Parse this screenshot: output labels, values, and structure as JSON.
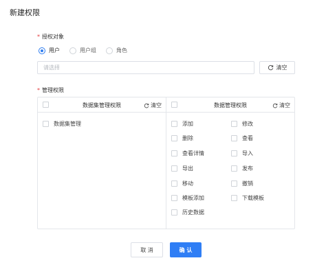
{
  "dialog": {
    "title": "新建权限"
  },
  "auth_target": {
    "label": "授权对象",
    "options": [
      {
        "label": "用户",
        "checked": true
      },
      {
        "label": "用户组",
        "checked": false
      },
      {
        "label": "角色",
        "checked": false
      }
    ],
    "select_placeholder": "请选择",
    "clear_label": "清空"
  },
  "manage_perm": {
    "label": "管理权限",
    "left_panel": {
      "title": "数据集管理权限",
      "clear_label": "清空",
      "items": [
        "数据集管理"
      ]
    },
    "right_panel": {
      "title": "数据管理权限",
      "clear_label": "清空",
      "items": [
        "添加",
        "修改",
        "删除",
        "查看",
        "查看详情",
        "导入",
        "导出",
        "发布",
        "移动",
        "撤销",
        "模板添加",
        "下载模板",
        "历史数据"
      ]
    }
  },
  "footer": {
    "cancel_label": "取 消",
    "ok_label": "确 认"
  },
  "colors": {
    "primary": "#2f7ef5",
    "required": "#e4393c",
    "border": "#dcdfe6"
  }
}
